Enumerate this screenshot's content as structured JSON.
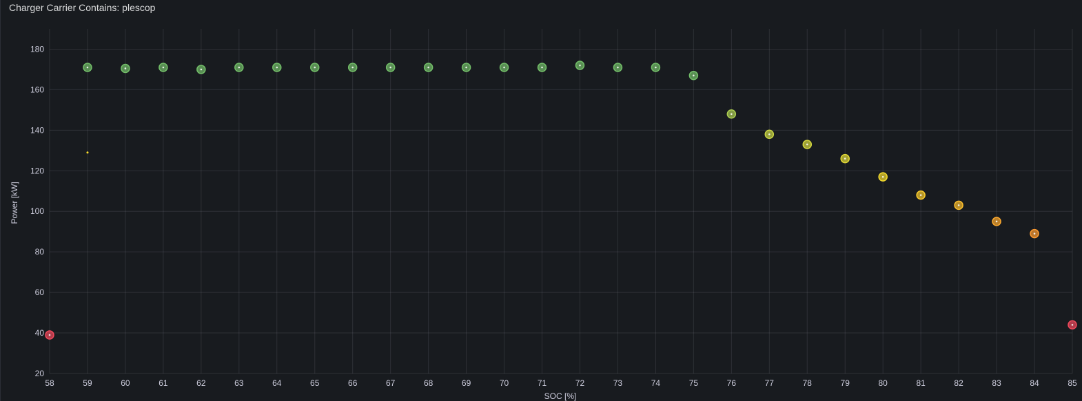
{
  "panel": {
    "title": "Charger Carrier Contains: plescop"
  },
  "chart_data": {
    "type": "scatter",
    "title": "Charger Carrier Contains: plescop",
    "xlabel": "SOC [%]",
    "ylabel": "Power [kW]",
    "xlim": [
      58,
      85
    ],
    "ylim": [
      20,
      190
    ],
    "xticks": [
      58,
      59,
      60,
      61,
      62,
      63,
      64,
      65,
      66,
      67,
      68,
      69,
      70,
      71,
      72,
      73,
      74,
      75,
      76,
      77,
      78,
      79,
      80,
      81,
      82,
      83,
      84,
      85
    ],
    "yticks": [
      20,
      40,
      60,
      80,
      100,
      120,
      140,
      160,
      180
    ],
    "grid": true,
    "legend": "none",
    "color_scale": {
      "low": "#f2495c",
      "mid_low": "#ff9830",
      "mid": "#fade2a",
      "high": "#73bf69"
    },
    "points": [
      {
        "x": 58,
        "y": 39,
        "size": "large"
      },
      {
        "x": 59,
        "y": 171,
        "size": "large"
      },
      {
        "x": 59,
        "y": 129,
        "size": "small"
      },
      {
        "x": 60,
        "y": 170.5,
        "size": "large"
      },
      {
        "x": 61,
        "y": 171,
        "size": "large"
      },
      {
        "x": 62,
        "y": 170,
        "size": "large"
      },
      {
        "x": 63,
        "y": 171,
        "size": "large"
      },
      {
        "x": 64,
        "y": 171,
        "size": "large"
      },
      {
        "x": 65,
        "y": 171,
        "size": "large"
      },
      {
        "x": 66,
        "y": 171,
        "size": "large"
      },
      {
        "x": 67,
        "y": 171,
        "size": "large"
      },
      {
        "x": 68,
        "y": 171,
        "size": "large"
      },
      {
        "x": 69,
        "y": 171,
        "size": "large"
      },
      {
        "x": 70,
        "y": 171,
        "size": "large"
      },
      {
        "x": 71,
        "y": 171,
        "size": "large"
      },
      {
        "x": 72,
        "y": 172,
        "size": "large"
      },
      {
        "x": 73,
        "y": 171,
        "size": "large"
      },
      {
        "x": 74,
        "y": 171,
        "size": "large"
      },
      {
        "x": 75,
        "y": 167,
        "size": "large"
      },
      {
        "x": 76,
        "y": 148,
        "size": "large"
      },
      {
        "x": 77,
        "y": 138,
        "size": "large"
      },
      {
        "x": 78,
        "y": 133,
        "size": "large"
      },
      {
        "x": 79,
        "y": 126,
        "size": "large"
      },
      {
        "x": 80,
        "y": 117,
        "size": "large"
      },
      {
        "x": 81,
        "y": 108,
        "size": "large"
      },
      {
        "x": 82,
        "y": 103,
        "size": "large"
      },
      {
        "x": 83,
        "y": 95,
        "size": "large"
      },
      {
        "x": 84,
        "y": 89,
        "size": "large"
      },
      {
        "x": 85,
        "y": 44,
        "size": "large"
      }
    ]
  }
}
